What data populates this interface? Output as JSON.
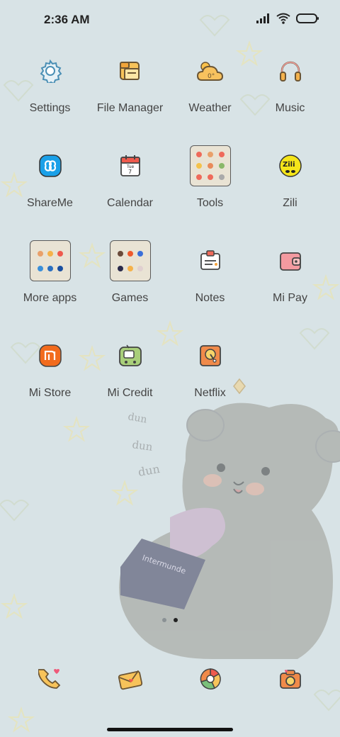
{
  "status": {
    "time": "2:36 AM"
  },
  "apps": [
    {
      "name": "settings",
      "label": "Settings"
    },
    {
      "name": "file-manager",
      "label": "File Manager"
    },
    {
      "name": "weather",
      "label": "Weather",
      "temp": "0°"
    },
    {
      "name": "music",
      "label": "Music"
    },
    {
      "name": "shareme",
      "label": "ShareMe"
    },
    {
      "name": "calendar",
      "label": "Calendar",
      "day_abbr": "Tue",
      "day_num": "7"
    },
    {
      "name": "tools",
      "label": "Tools"
    },
    {
      "name": "zili",
      "label": "Zili",
      "badge": "Zili"
    },
    {
      "name": "more-apps",
      "label": "More apps"
    },
    {
      "name": "games",
      "label": "Games"
    },
    {
      "name": "notes",
      "label": "Notes"
    },
    {
      "name": "mi-pay",
      "label": "Mi Pay"
    },
    {
      "name": "mi-store",
      "label": "Mi Store"
    },
    {
      "name": "mi-credit",
      "label": "Mi Credit"
    },
    {
      "name": "netflix",
      "label": "Netflix"
    }
  ],
  "dock": [
    {
      "name": "phone",
      "icon": "phone-icon"
    },
    {
      "name": "messages",
      "icon": "message-envelope-icon"
    },
    {
      "name": "browser",
      "icon": "browser-icon"
    },
    {
      "name": "camera",
      "icon": "camera-icon"
    }
  ],
  "wallpaper": {
    "doodle_words": [
      "dun",
      "dun",
      "dun"
    ],
    "card_text": "Intermunde"
  },
  "colors": {
    "background": "#d8e3e6",
    "label": "#444444",
    "accent_orange": "#f5a33c"
  }
}
